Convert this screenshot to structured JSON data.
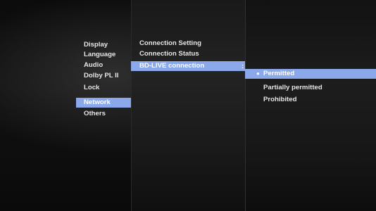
{
  "main_menu": [
    {
      "label": "Display",
      "selected": false
    },
    {
      "label": "Language",
      "selected": false
    },
    {
      "label": "Audio",
      "selected": false
    },
    {
      "label": "Dolby PL II",
      "selected": false
    },
    {
      "label": "Lock",
      "selected": false
    },
    {
      "label": "Network",
      "selected": true
    },
    {
      "label": "Others",
      "selected": false
    }
  ],
  "sub_menu": [
    {
      "label": "Connection Setting",
      "selected": false
    },
    {
      "label": "Connection Status",
      "selected": false
    },
    {
      "label": "BD-LIVE connection",
      "selected": true,
      "arrow": ":"
    }
  ],
  "options": [
    {
      "label": "Permitted",
      "selected": true,
      "bullet": "●"
    },
    {
      "label": "Partially permitted",
      "selected": false
    },
    {
      "label": "Prohibited",
      "selected": false
    }
  ],
  "colors": {
    "highlight": "#8aa8ea",
    "text": "#e6e6e6"
  }
}
